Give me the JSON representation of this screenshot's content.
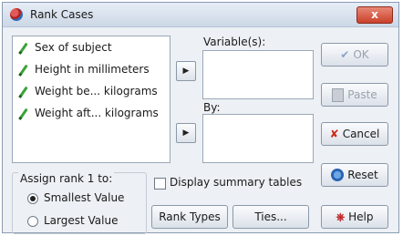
{
  "window": {
    "title": "Rank Cases",
    "close_label": "x"
  },
  "variables": [
    {
      "label": "Sex of subject"
    },
    {
      "label": "Height in millimeters"
    },
    {
      "label": "Weight be... kilograms"
    },
    {
      "label": "Weight aft... kilograms"
    }
  ],
  "labels": {
    "variables": "Variable(s):",
    "by": "By:",
    "assign_rank": "Assign rank 1 to:"
  },
  "radio": {
    "smallest": "Smallest Value",
    "largest": "Largest Value",
    "selected": "smallest"
  },
  "display_summary": {
    "label": "Display summary tables",
    "checked": false
  },
  "buttons": {
    "ok": "OK",
    "paste": "Paste",
    "cancel": "Cancel",
    "reset": "Reset",
    "help": "Help",
    "rank_types": "Rank Types",
    "ties": "Ties..."
  },
  "arrow": "▶"
}
